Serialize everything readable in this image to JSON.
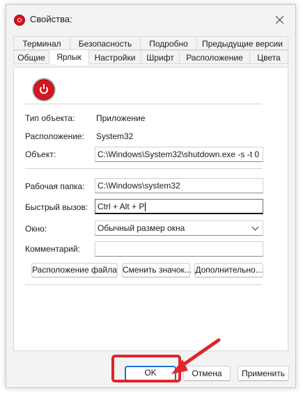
{
  "window": {
    "title": "Свойства:",
    "close_icon": "close-icon"
  },
  "tabs_row1": [
    "Терминал",
    "Безопасность",
    "Подробно",
    "Предыдущие версии"
  ],
  "tabs_row2": [
    "Общие",
    "Ярлык",
    "Настройки",
    "Шрифт",
    "Расположение",
    "Цвета"
  ],
  "active_tab": "Ярлык",
  "shortcut": {
    "icon": "power-icon",
    "type_label": "Тип объекта:",
    "type_value": "Приложение",
    "location_label": "Расположение:",
    "location_value": "System32",
    "target_label": "Объект:",
    "target_value": "C:\\Windows\\System32\\shutdown.exe -s -t 0",
    "workdir_label": "Рабочая папка:",
    "workdir_value": "C:\\Windows\\system32",
    "hotkey_label": "Быстрый вызов:",
    "hotkey_value": "Ctrl + Alt + P",
    "window_label": "Окно:",
    "window_value": "Обычный размер окна",
    "comment_label": "Комментарий:",
    "comment_value": "",
    "btn_file_location": "Расположение файла",
    "btn_change_icon": "Сменить значок...",
    "btn_advanced": "Дополнительно..."
  },
  "footer": {
    "ok": "OK",
    "cancel": "Отмена",
    "apply": "Применить"
  },
  "colors": {
    "annotation_red": "#e0252b",
    "ok_focus_blue": "#1f6fd1",
    "power_icon_red": "#d8161f"
  }
}
